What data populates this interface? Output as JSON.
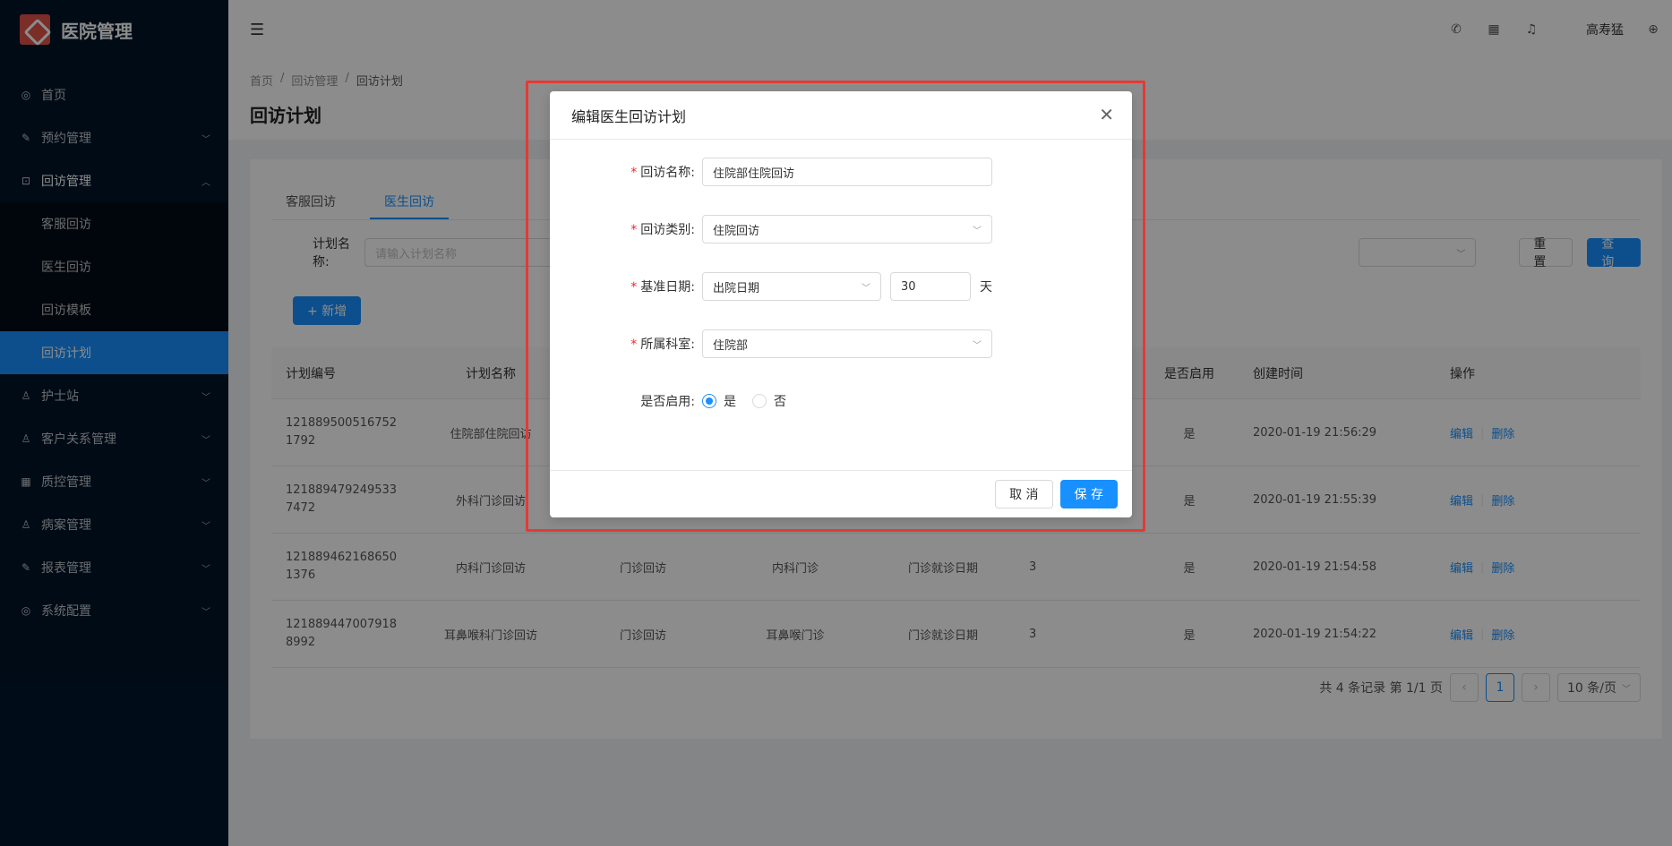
{
  "app": {
    "title": "医院管理"
  },
  "sidebar": {
    "items": [
      {
        "label": "首页",
        "icon": "dashboard-icon"
      },
      {
        "label": "预约管理",
        "icon": "edit-icon",
        "chevron": "down"
      },
      {
        "label": "回访管理",
        "icon": "lock-icon",
        "chevron": "up"
      },
      {
        "label": "护士站",
        "icon": "user-icon",
        "chevron": "down"
      },
      {
        "label": "客户关系管理",
        "icon": "user-icon",
        "chevron": "down"
      },
      {
        "label": "质控管理",
        "icon": "table-icon",
        "chevron": "down"
      },
      {
        "label": "病案管理",
        "icon": "user-icon",
        "chevron": "down"
      },
      {
        "label": "报表管理",
        "icon": "edit-icon",
        "chevron": "down"
      },
      {
        "label": "系统配置",
        "icon": "dashboard-icon",
        "chevron": "down"
      }
    ],
    "submenu": [
      {
        "label": "客服回访"
      },
      {
        "label": "医生回访"
      },
      {
        "label": "回访模板"
      },
      {
        "label": "回访计划",
        "active": true
      }
    ]
  },
  "header": {
    "user": "高寿猛"
  },
  "breadcrumb": [
    "首页",
    "回访管理",
    "回访计划"
  ],
  "page": {
    "title": "回访计划"
  },
  "tabs": [
    {
      "label": "客服回访"
    },
    {
      "label": "医生回访",
      "active": true
    }
  ],
  "search": {
    "label": "计划名称:",
    "placeholder": "请输入计划名称",
    "reset": "重 置",
    "query": "查 询"
  },
  "add_button": "+ 新增",
  "table": {
    "headers": [
      "计划编号",
      "计划名称",
      "",
      "",
      "",
      "",
      "是否启用",
      "创建时间",
      "操作"
    ],
    "rows": [
      {
        "id": "1218895005167521792",
        "name": "住院部住院回访",
        "type": "",
        "dept": "",
        "base": "",
        "days": "",
        "enabled": "是",
        "created": "2020-01-19 21:56:29"
      },
      {
        "id": "1218894792495337472",
        "name": "外科门诊回访",
        "type": "",
        "dept": "",
        "base": "",
        "days": "",
        "enabled": "是",
        "created": "2020-01-19 21:55:39"
      },
      {
        "id": "1218894621686501376",
        "name": "内科门诊回访",
        "type": "门诊回访",
        "dept": "内科门诊",
        "base": "门诊就诊日期",
        "days": "3",
        "enabled": "是",
        "created": "2020-01-19 21:54:58"
      },
      {
        "id": "1218894470079188992",
        "name": "耳鼻喉科门诊回访",
        "type": "门诊回访",
        "dept": "耳鼻喉门诊",
        "base": "门诊就诊日期",
        "days": "3",
        "enabled": "是",
        "created": "2020-01-19 21:54:22"
      }
    ],
    "edit": "编辑",
    "delete": "删除"
  },
  "pager": {
    "summary": "共 4 条记录 第 1/1 页",
    "current": "1",
    "size": "10 条/页"
  },
  "modal": {
    "title": "编辑医生回访计划",
    "fields": {
      "name_label": "回访名称:",
      "name_value": "住院部住院回访",
      "type_label": "回访类别:",
      "type_value": "住院回访",
      "base_label": "基准日期:",
      "base_value": "出院日期",
      "days_value": "30",
      "days_unit": "天",
      "dept_label": "所属科室:",
      "dept_value": "住院部",
      "enabled_label": "是否启用:",
      "enabled_yes": "是",
      "enabled_no": "否",
      "enabled_selected": "是"
    },
    "cancel": "取 消",
    "save": "保 存"
  },
  "colors": {
    "primary": "#1890ff",
    "sidebar_bg": "#001529",
    "highlight": "#e53935",
    "required": "#f5222d"
  }
}
